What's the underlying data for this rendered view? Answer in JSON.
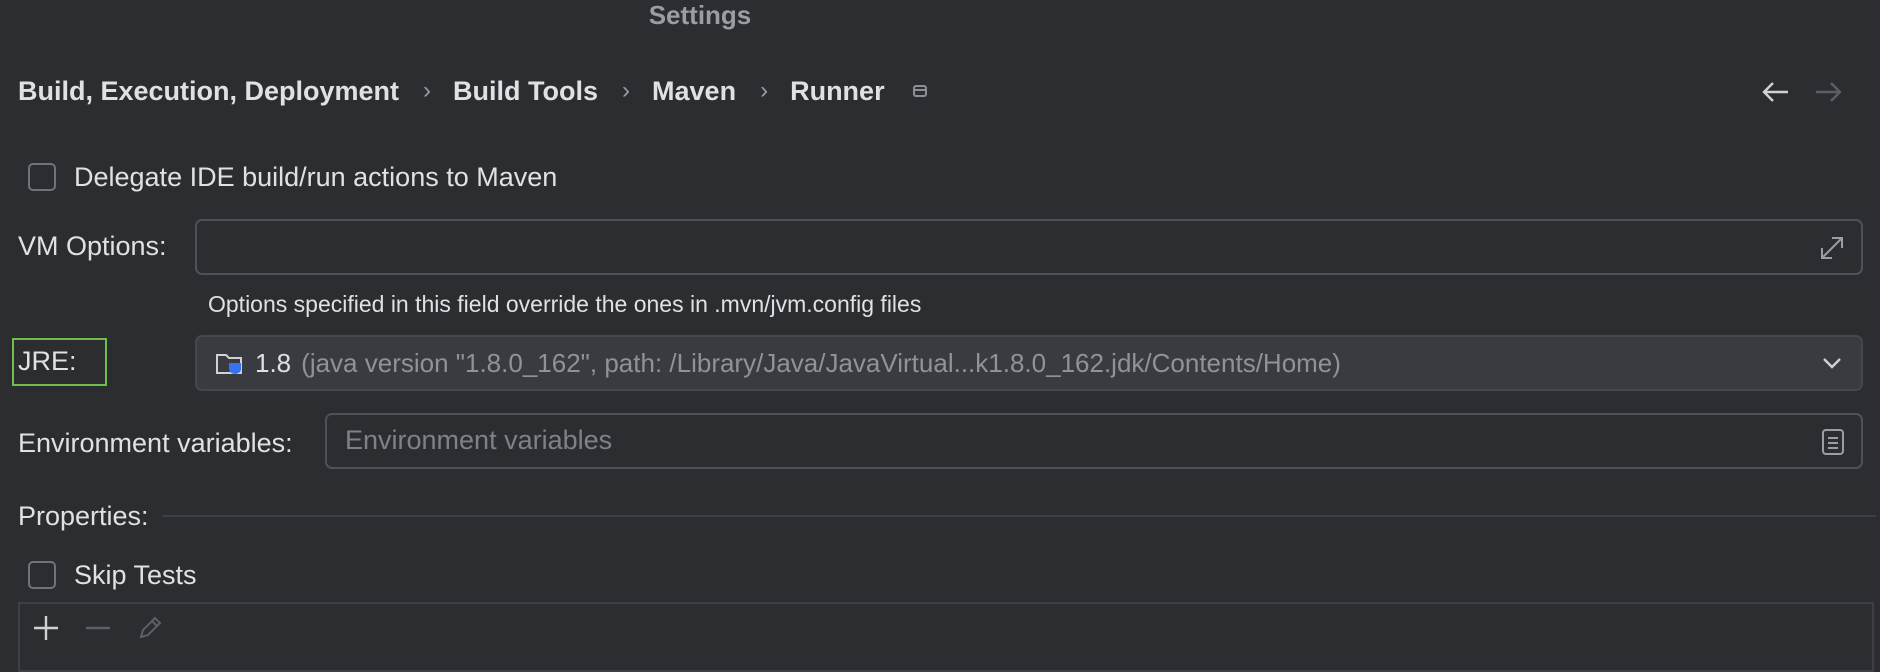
{
  "window": {
    "title": "Settings"
  },
  "breadcrumb": {
    "items": [
      "Build, Execution, Deployment",
      "Build Tools",
      "Maven",
      "Runner"
    ],
    "separator": "›"
  },
  "navigation": {
    "back_icon": "arrow-left-icon",
    "forward_icon": "arrow-right-icon"
  },
  "delegate": {
    "label": "Delegate IDE build/run actions to Maven",
    "checked": false
  },
  "vm_options": {
    "label": "VM Options:",
    "value": "",
    "hint": "Options specified in this field override the ones in .mvn/jvm.config files"
  },
  "jre": {
    "label": "JRE:",
    "selected": "1.8",
    "detail": "(java version \"1.8.0_162\", path: /Library/Java/JavaVirtual...k1.8.0_162.jdk/Contents/Home)"
  },
  "env": {
    "label": "Environment variables:",
    "placeholder": "Environment variables"
  },
  "properties": {
    "label": "Properties:"
  },
  "skip_tests": {
    "label": "Skip Tests",
    "checked": false
  },
  "toolbar": {
    "add_icon": "plus-icon",
    "remove_icon": "minus-icon",
    "edit_icon": "pencil-icon"
  },
  "colors": {
    "highlight": "#6fbf4f",
    "background": "#2b2d30",
    "combo_bg": "#393b40"
  }
}
